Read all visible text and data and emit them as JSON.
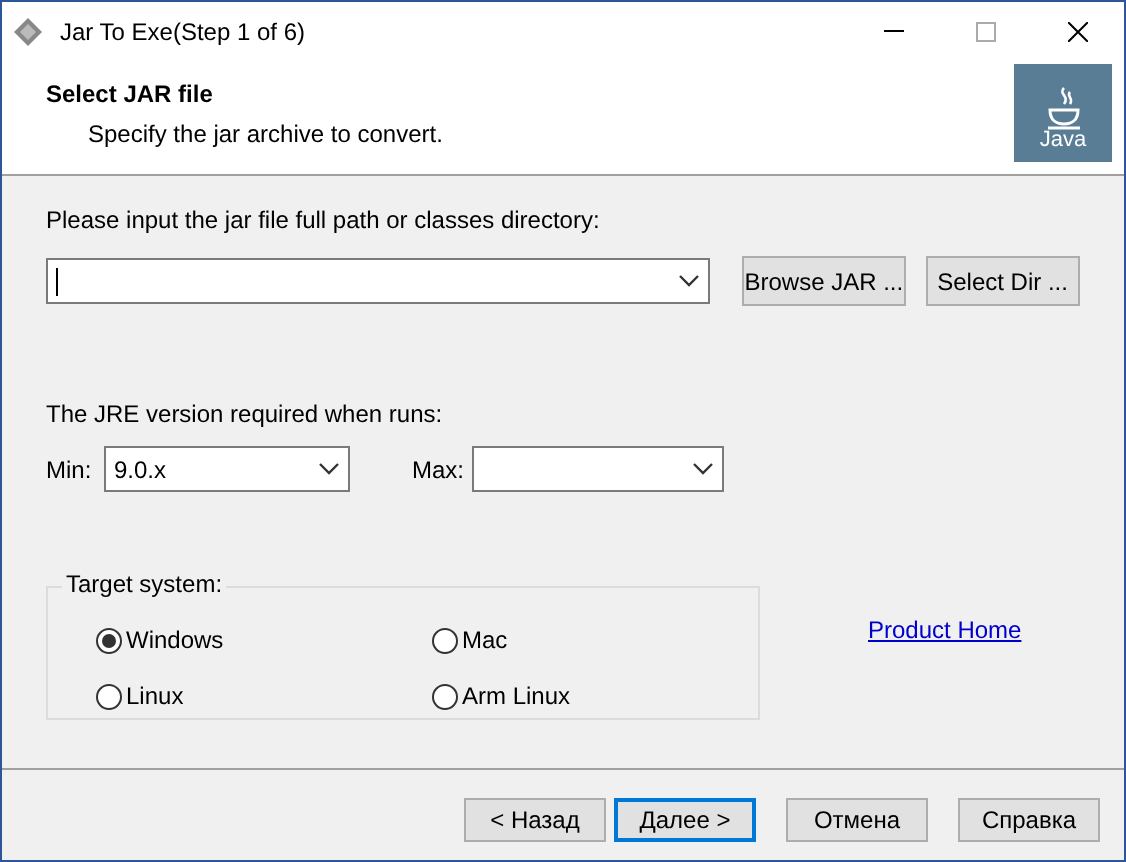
{
  "window": {
    "title": "Jar To Exe(Step 1 of 6)"
  },
  "header": {
    "title": "Select JAR file",
    "subtitle": "Specify the jar archive to convert.",
    "logo_text": "Java"
  },
  "jar_path": {
    "label": "Please input the jar file full path or classes directory:"
  },
  "browse_buttons": [
    "Browse JAR ...",
    "Select Dir ..."
  ],
  "jre": {
    "label": "The JRE version required when runs:",
    "min_label": "Min:",
    "min_value": "9.0.x",
    "max_label": "Max:"
  },
  "target_system": {
    "label": "Target system:",
    "options": [
      {
        "label": "Windows",
        "selected": true
      },
      {
        "label": "Mac",
        "selected": false
      },
      {
        "label": "Linux",
        "selected": false
      },
      {
        "label": "Arm Linux",
        "selected": false
      }
    ]
  },
  "link": "Product Home",
  "buttons": [
    {
      "label": "< Назад",
      "default": false
    },
    {
      "label": "Далее >",
      "default": true
    },
    {
      "label": "Отмена",
      "default": false
    },
    {
      "label": "Справка",
      "default": false
    }
  ]
}
